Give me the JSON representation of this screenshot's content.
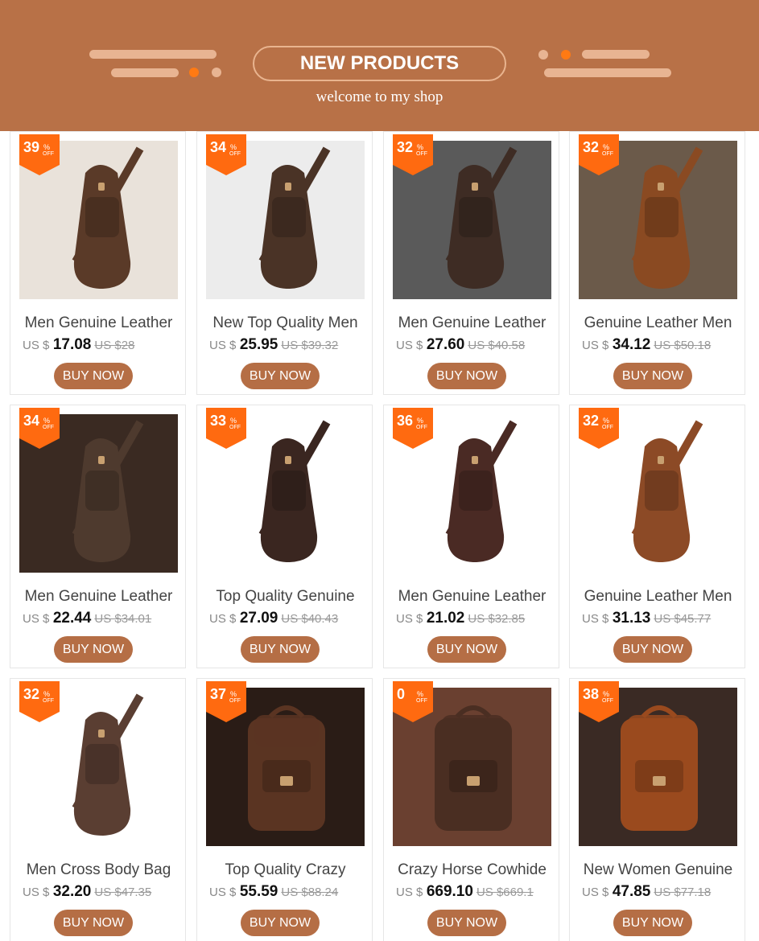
{
  "banner": {
    "title": "NEW PRODUCTS",
    "subtitle": "welcome to my shop",
    "bg_color": "#b87147",
    "accent_color": "#ff7a13"
  },
  "products": [
    {
      "name": "Men Genuine Leather",
      "currency": "US $",
      "price": "17.08",
      "old_price": "US $28",
      "discount": "39",
      "pct": "%",
      "off": "OFF",
      "button": "BUY NOW",
      "tone": "#5a3a28",
      "bg": "#e9e2da",
      "shape": "sling"
    },
    {
      "name": "New Top Quality Men",
      "currency": "US $",
      "price": "25.95",
      "old_price": "US $39.32",
      "discount": "34",
      "pct": "%",
      "off": "OFF",
      "button": "BUY NOW",
      "tone": "#4a3326",
      "bg": "#ececec",
      "shape": "sling"
    },
    {
      "name": "Men Genuine Leather",
      "currency": "US $",
      "price": "27.60",
      "old_price": "US $40.58",
      "discount": "32",
      "pct": "%",
      "off": "OFF",
      "button": "BUY NOW",
      "tone": "#3e2c24",
      "bg": "#5a5a5a",
      "shape": "sling"
    },
    {
      "name": "Genuine Leather Men",
      "currency": "US $",
      "price": "34.12",
      "old_price": "US $50.18",
      "discount": "32",
      "pct": "%",
      "off": "OFF",
      "button": "BUY NOW",
      "tone": "#8a4a22",
      "bg": "#6b5a4a",
      "shape": "sling"
    },
    {
      "name": "Men Genuine Leather",
      "currency": "US $",
      "price": "22.44",
      "old_price": "US $34.01",
      "discount": "34",
      "pct": "%",
      "off": "OFF",
      "button": "BUY NOW",
      "tone": "#4e3a2e",
      "bg": "#3a2a22",
      "shape": "sling"
    },
    {
      "name": "Top Quality Genuine",
      "currency": "US $",
      "price": "27.09",
      "old_price": "US $40.43",
      "discount": "33",
      "pct": "%",
      "off": "OFF",
      "button": "BUY NOW",
      "tone": "#3a2620",
      "bg": "#ffffff",
      "shape": "sling"
    },
    {
      "name": "Men Genuine Leather",
      "currency": "US $",
      "price": "21.02",
      "old_price": "US $32.85",
      "discount": "36",
      "pct": "%",
      "off": "OFF",
      "button": "BUY NOW",
      "tone": "#4a2a24",
      "bg": "#ffffff",
      "shape": "sling"
    },
    {
      "name": "Genuine Leather Men",
      "currency": "US $",
      "price": "31.13",
      "old_price": "US $45.77",
      "discount": "32",
      "pct": "%",
      "off": "OFF",
      "button": "BUY NOW",
      "tone": "#8c4a26",
      "bg": "#ffffff",
      "shape": "sling"
    },
    {
      "name": "Men Cross Body Bag",
      "currency": "US $",
      "price": "32.20",
      "old_price": "US $47.35",
      "discount": "32",
      "pct": "%",
      "off": "OFF",
      "button": "BUY NOW",
      "tone": "#5a3e32",
      "bg": "#ffffff",
      "shape": "sling"
    },
    {
      "name": "Top Quality Crazy",
      "currency": "US $",
      "price": "55.59",
      "old_price": "US $88.24",
      "discount": "37",
      "pct": "%",
      "off": "OFF",
      "button": "BUY NOW",
      "tone": "#5a3422",
      "bg": "#2a1c16",
      "shape": "backpack"
    },
    {
      "name": "Crazy Horse Cowhide",
      "currency": "US $",
      "price": "669.10",
      "old_price": "US $669.1",
      "discount": "0",
      "pct": "%",
      "off": "OFF",
      "button": "BUY NOW",
      "tone": "#4a2e22",
      "bg": "#6a4030",
      "shape": "backpack"
    },
    {
      "name": "New Women Genuine",
      "currency": "US $",
      "price": "47.85",
      "old_price": "US $77.18",
      "discount": "38",
      "pct": "%",
      "off": "OFF",
      "button": "BUY NOW",
      "tone": "#9a4a1e",
      "bg": "#3a2a24",
      "shape": "backpack"
    }
  ]
}
